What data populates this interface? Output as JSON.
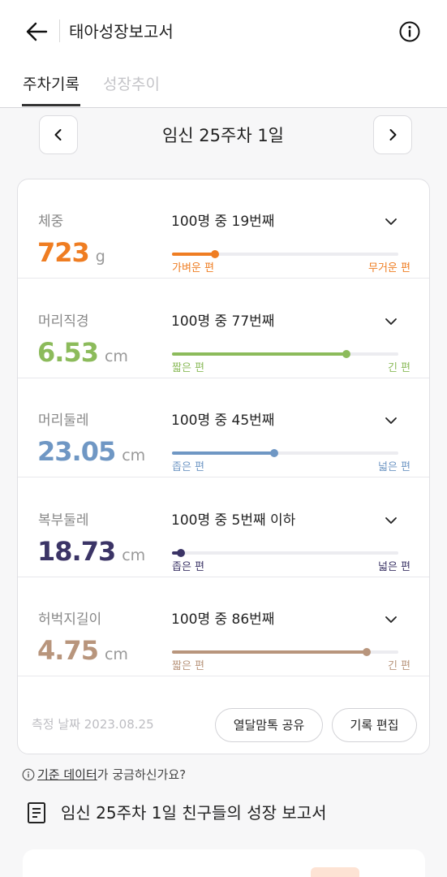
{
  "header": {
    "title": "태아성장보고서"
  },
  "tabs": [
    {
      "label": "주차기록",
      "active": true
    },
    {
      "label": "성장추이",
      "active": false
    }
  ],
  "week_nav": {
    "label": "임신 25주차 1일"
  },
  "metrics": [
    {
      "name": "체중",
      "value": "723",
      "unit": "g",
      "rank": "100명 중 19번째",
      "percentile": 0.19,
      "low": "가벼운 편",
      "high": "무거운 편",
      "color": "#ef7d22"
    },
    {
      "name": "머리직경",
      "value": "6.53",
      "unit": "cm",
      "rank": "100명 중 77번째",
      "percentile": 0.77,
      "low": "짧은 편",
      "high": "긴 편",
      "color": "#8cbb5b"
    },
    {
      "name": "머리둘레",
      "value": "23.05",
      "unit": "cm",
      "rank": "100명 중 45번째",
      "percentile": 0.45,
      "low": "좁은 편",
      "high": "넓은 편",
      "color": "#6f97c4"
    },
    {
      "name": "복부둘레",
      "value": "18.73",
      "unit": "cm",
      "rank": "100명 중 5번째 이하",
      "percentile": 0.04,
      "low": "좁은 편",
      "high": "넓은 편",
      "color": "#3b3466"
    },
    {
      "name": "허벅지길이",
      "value": "4.75",
      "unit": "cm",
      "rank": "100명 중 86번째",
      "percentile": 0.86,
      "low": "짧은 편",
      "high": "긴 편",
      "color": "#b8957c"
    }
  ],
  "footer": {
    "measure_date": "측정 날짜 2023.08.25",
    "share_label": "열달맘톡 공유",
    "edit_label": "기록 편집"
  },
  "standard_question": {
    "link": "기준 데이터",
    "suffix": "가 궁금하신가요?"
  },
  "report": {
    "title": "임신 25주차 1일 친구들의 성장 보고서"
  },
  "icons": {
    "back": "back-arrow-icon",
    "info": "info-icon",
    "prev": "chevron-left-icon",
    "next": "chevron-right-icon",
    "expand": "chevron-down-icon",
    "report": "document-icon"
  }
}
